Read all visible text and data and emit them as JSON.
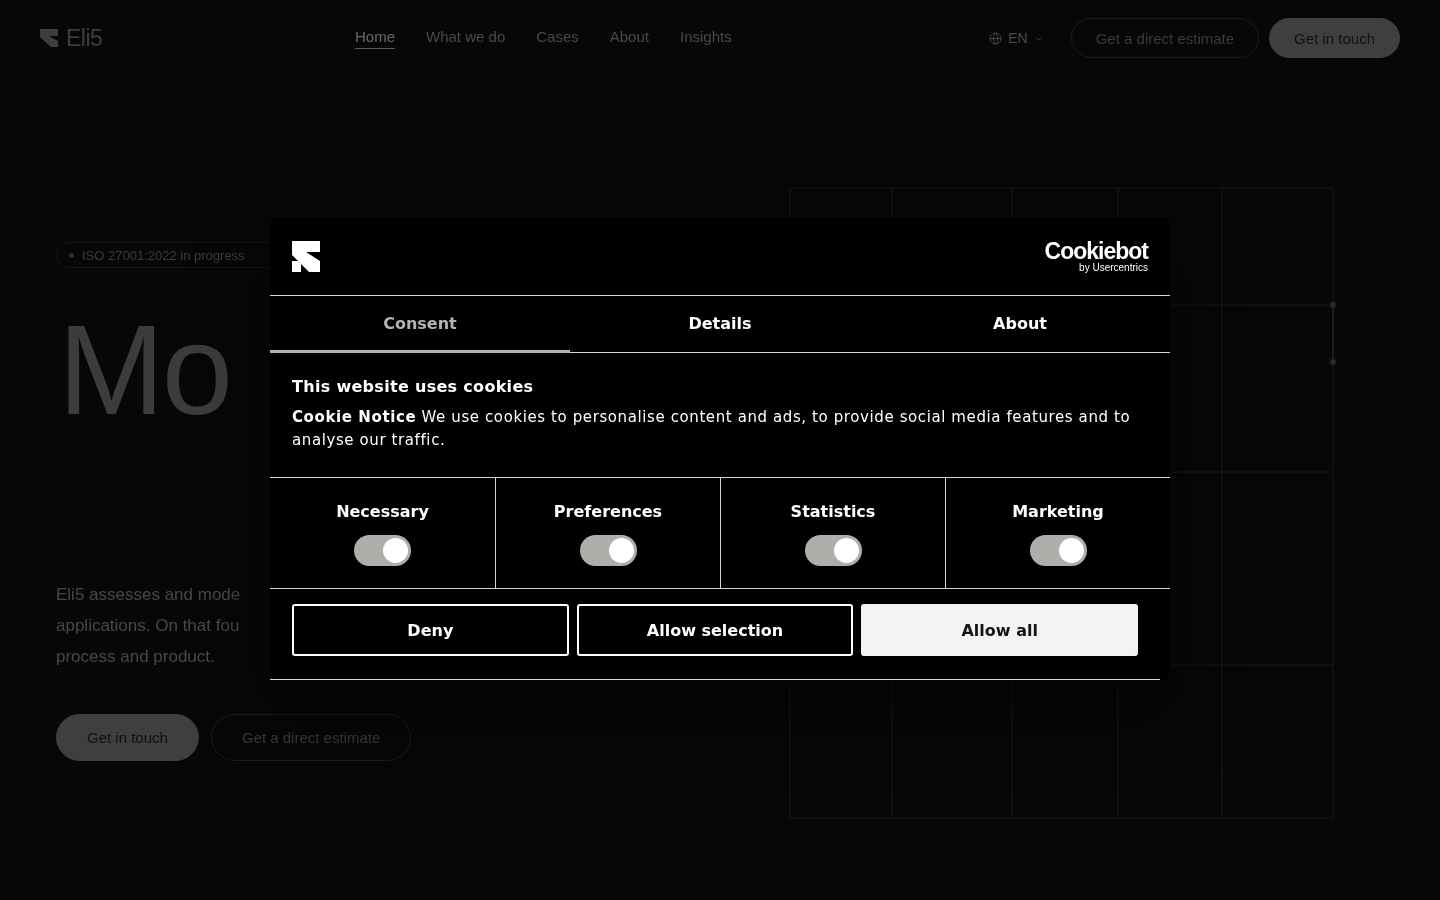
{
  "header": {
    "logo": "Eli5",
    "nav": [
      {
        "label": "Home",
        "selected": true
      },
      {
        "label": "What we do",
        "selected": false
      },
      {
        "label": "Cases",
        "selected": false
      },
      {
        "label": "About",
        "selected": false
      },
      {
        "label": "Insights",
        "selected": false
      }
    ],
    "language": "EN",
    "estimate_button": "Get a direct estimate",
    "contact_button": "Get in touch"
  },
  "hero": {
    "badge": "ISO 27001:2022 in progress",
    "heading": "Mo",
    "lines": [
      "Eli5 assesses and mode",
      "applications. On that fou",
      "process and product."
    ],
    "primary_button": "Get in touch",
    "secondary_button": "Get a direct estimate"
  },
  "cookie_dialog": {
    "brand": "Cookiebot",
    "brand_sub": "by Usercentrics",
    "tabs": [
      {
        "label": "Consent",
        "selected": true
      },
      {
        "label": "Details",
        "selected": false
      },
      {
        "label": "About",
        "selected": false
      }
    ],
    "title": "This website uses cookies",
    "text": "**Cookie Notice** We use cookies to personalise content and ads, to provide social media features and to analyse our traffic.",
    "categories": [
      {
        "label": "Necessary",
        "checked": true
      },
      {
        "label": "Preferences",
        "checked": true
      },
      {
        "label": "Statistics",
        "checked": true
      },
      {
        "label": "Marketing",
        "checked": true
      }
    ],
    "buttons": [
      {
        "label": "Deny",
        "kind": "outline"
      },
      {
        "label": "Allow selection",
        "kind": "outline"
      },
      {
        "label": "Allow all",
        "kind": "filled"
      }
    ]
  }
}
